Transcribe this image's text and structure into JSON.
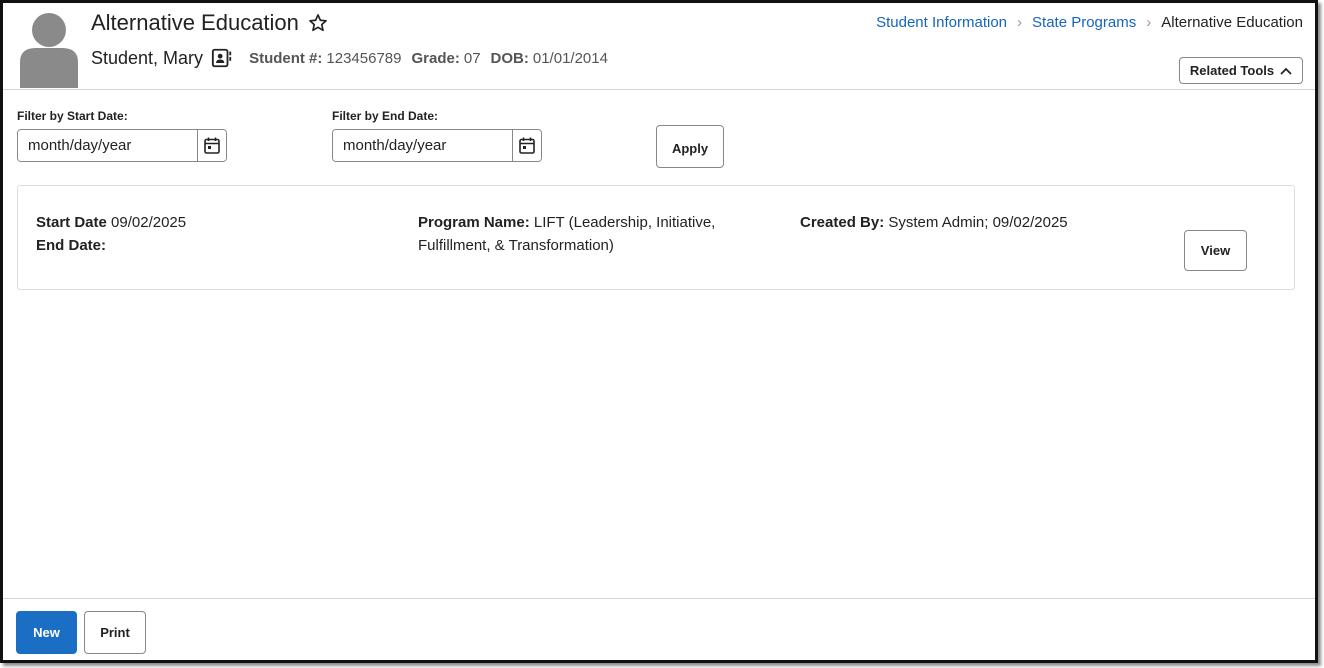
{
  "header": {
    "title": "Alternative Education",
    "favorite_icon": "star-outline-icon",
    "avatar_icon": "person-silhouette-icon",
    "student_name": "Student, Mary",
    "contact_icon": "contact-card-icon",
    "student_number_label": "Student #:",
    "student_number": "123456789",
    "grade_label": "Grade:",
    "grade": "07",
    "dob_label": "DOB:",
    "dob": "01/01/2014",
    "breadcrumb": {
      "items": [
        "Student Information",
        "State Programs"
      ],
      "current": "Alternative Education"
    },
    "related_tools_label": "Related Tools"
  },
  "filters": {
    "start": {
      "label": "Filter by Start Date:",
      "placeholder": "month/day/year",
      "value": ""
    },
    "end": {
      "label": "Filter by End Date:",
      "placeholder": "month/day/year",
      "value": ""
    },
    "apply_label": "Apply"
  },
  "records": [
    {
      "start_date_label": "Start Date",
      "start_date": "09/02/2025",
      "end_date_label": "End Date:",
      "end_date": "",
      "program_name_label": "Program Name:",
      "program_name_line1": "LIFT (Leadership, Initiative,",
      "program_name_line2": "Fulfillment, & Transformation)",
      "created_by_label": "Created By:",
      "created_by": "System Admin; 09/02/2025",
      "view_label": "View"
    }
  ],
  "footer": {
    "new_label": "New",
    "print_label": "Print"
  },
  "colors": {
    "primary": "#1a6fc4",
    "link": "#1565c0",
    "avatar": "#8a8a8a"
  }
}
